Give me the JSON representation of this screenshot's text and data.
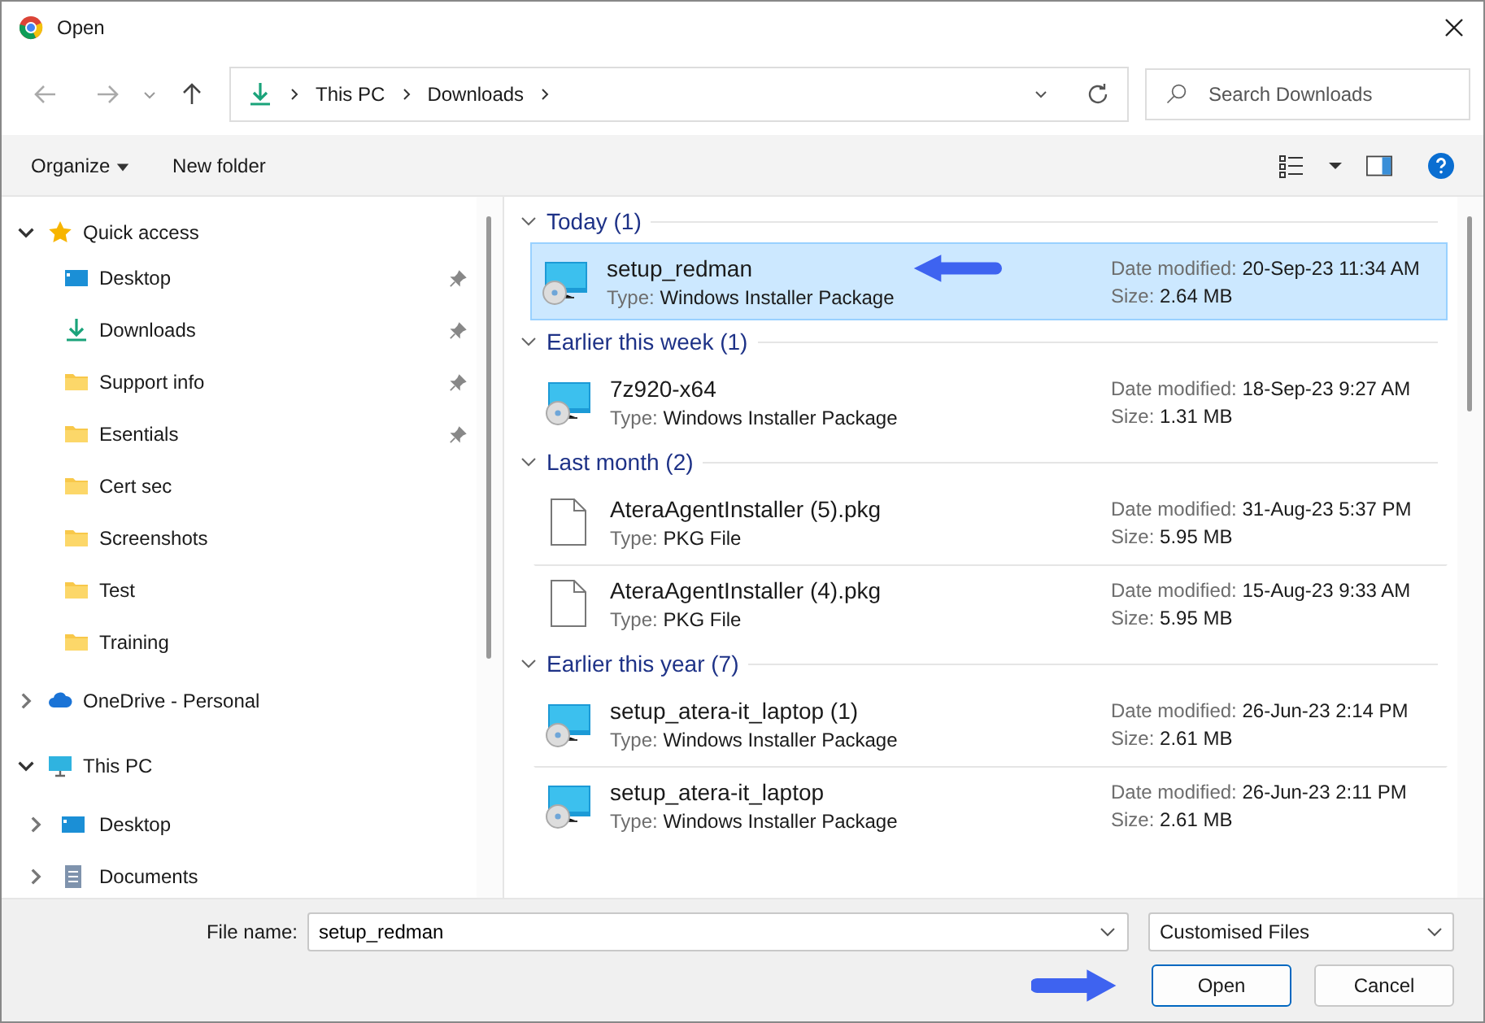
{
  "window": {
    "title": "Open"
  },
  "nav": {
    "path": [
      "This PC",
      "Downloads"
    ],
    "search_placeholder": "Search Downloads"
  },
  "toolbar": {
    "organize": "Organize",
    "new_folder": "New folder"
  },
  "sidebar": {
    "items": [
      {
        "label": "Quick access",
        "kind": "star",
        "expanded": true,
        "children": [
          {
            "label": "Desktop",
            "kind": "desktop",
            "pinned": true
          },
          {
            "label": "Downloads",
            "kind": "download",
            "pinned": true
          },
          {
            "label": "Support info",
            "kind": "folder",
            "pinned": true
          },
          {
            "label": "Esentials",
            "kind": "folder",
            "pinned": true
          },
          {
            "label": "Cert sec",
            "kind": "folder",
            "pinned": false
          },
          {
            "label": "Screenshots",
            "kind": "folder",
            "pinned": false
          },
          {
            "label": "Test",
            "kind": "folder",
            "pinned": false
          },
          {
            "label": "Training",
            "kind": "folder",
            "pinned": false
          }
        ]
      },
      {
        "label": "OneDrive - Personal",
        "kind": "cloud",
        "expanded": false
      },
      {
        "label": "This PC",
        "kind": "pc",
        "expanded": true,
        "children": [
          {
            "label": "Desktop",
            "kind": "desktop",
            "expanded": false
          },
          {
            "label": "Documents",
            "kind": "documents",
            "expanded": false
          }
        ]
      }
    ]
  },
  "groups": [
    {
      "title": "Today (1)",
      "items": [
        {
          "name": "setup_redman",
          "kind": "installer",
          "selected": true,
          "type_label": "Type:",
          "type": "Windows Installer Package",
          "date_label": "Date modified:",
          "date": "20-Sep-23 11:34 AM",
          "size_label": "Size:",
          "size": "2.64 MB"
        }
      ]
    },
    {
      "title": "Earlier this week (1)",
      "items": [
        {
          "name": "7z920-x64",
          "kind": "installer",
          "selected": false,
          "type_label": "Type:",
          "type": "Windows Installer Package",
          "date_label": "Date modified:",
          "date": "18-Sep-23 9:27 AM",
          "size_label": "Size:",
          "size": "1.31 MB"
        }
      ]
    },
    {
      "title": "Last month (2)",
      "items": [
        {
          "name": "AteraAgentInstaller (5).pkg",
          "kind": "file",
          "selected": false,
          "type_label": "Type:",
          "type": "PKG File",
          "date_label": "Date modified:",
          "date": "31-Aug-23 5:37 PM",
          "size_label": "Size:",
          "size": "5.95 MB"
        },
        {
          "name": "AteraAgentInstaller (4).pkg",
          "kind": "file",
          "selected": false,
          "type_label": "Type:",
          "type": "PKG File",
          "date_label": "Date modified:",
          "date": "15-Aug-23 9:33 AM",
          "size_label": "Size:",
          "size": "5.95 MB"
        }
      ]
    },
    {
      "title": "Earlier this year (7)",
      "items": [
        {
          "name": "setup_atera-it_laptop (1)",
          "kind": "installer",
          "selected": false,
          "type_label": "Type:",
          "type": "Windows Installer Package",
          "date_label": "Date modified:",
          "date": "26-Jun-23 2:14 PM",
          "size_label": "Size:",
          "size": "2.61 MB"
        },
        {
          "name": "setup_atera-it_laptop",
          "kind": "installer",
          "selected": false,
          "type_label": "Type:",
          "type": "Windows Installer Package",
          "date_label": "Date modified:",
          "date": "26-Jun-23 2:11 PM",
          "size_label": "Size:",
          "size": "2.61 MB"
        }
      ]
    }
  ],
  "footer": {
    "file_name_label": "File name:",
    "file_name": "setup_redman",
    "filter": "Customised Files",
    "open": "Open",
    "cancel": "Cancel"
  }
}
